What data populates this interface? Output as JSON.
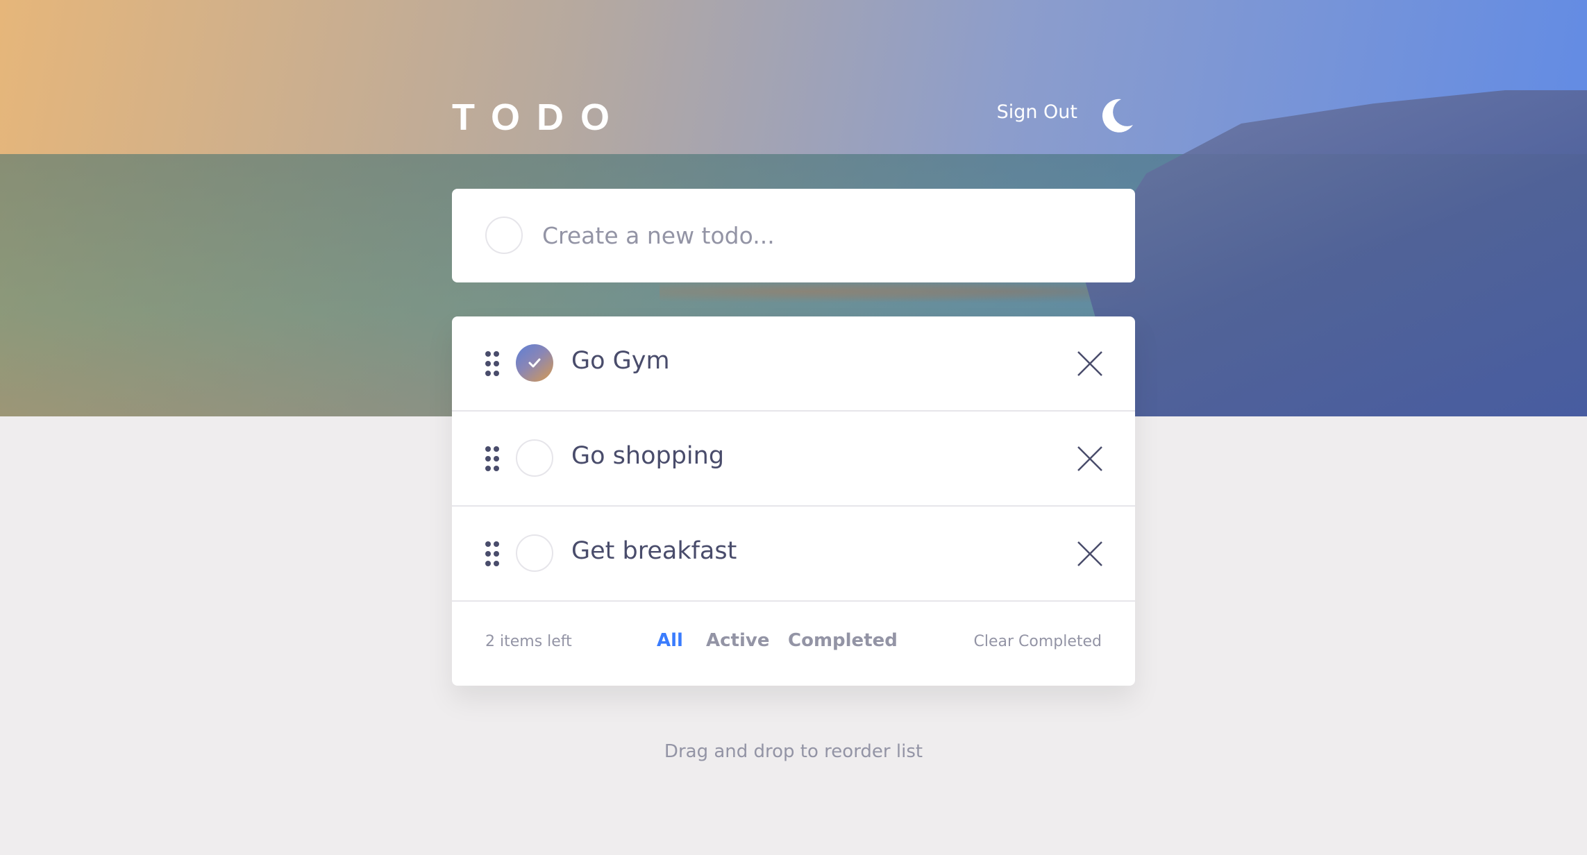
{
  "app": {
    "title": "TODO",
    "sign_out_label": "Sign Out",
    "theme_icon": "moon-icon"
  },
  "new_todo": {
    "placeholder": "Create a new todo..."
  },
  "todos": [
    {
      "text": "Go Gym",
      "completed": true
    },
    {
      "text": "Go shopping",
      "completed": false
    },
    {
      "text": "Get breakfast",
      "completed": false
    }
  ],
  "footer": {
    "items_left": "2 items left",
    "filters": [
      "All",
      "Active",
      "Completed"
    ],
    "active_filter": "All",
    "clear_label": "Clear Completed"
  },
  "hint": "Drag and drop to reorder list",
  "colors": {
    "accent": "#3a7cfd",
    "text": "#494c6b",
    "muted": "#9394a5",
    "background": "#efedee",
    "check_gradient_start": "#5d7fd6",
    "check_gradient_end": "#d79a4f"
  }
}
